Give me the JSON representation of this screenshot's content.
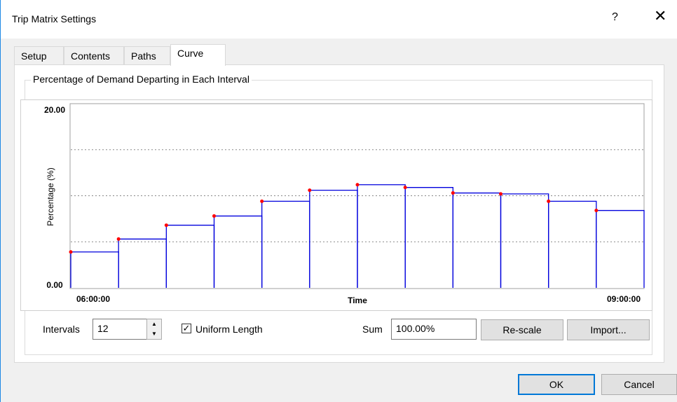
{
  "window": {
    "title": "Trip Matrix Settings",
    "help_glyph": "?",
    "close_glyph": "✕"
  },
  "tabs": [
    {
      "label": "Setup",
      "active": false
    },
    {
      "label": "Contents",
      "active": false
    },
    {
      "label": "Paths",
      "active": false
    },
    {
      "label": "Curve",
      "active": true
    }
  ],
  "group": {
    "label": "Percentage of Demand Departing in Each Interval"
  },
  "chart_data": {
    "type": "step",
    "ylabel": "Percentage (%)",
    "xlabel": "Time",
    "ymin_label": "0.00",
    "ymax_label": "20.00",
    "x_start_label": "06:00:00",
    "x_end_label": "09:00:00",
    "ylim": [
      0,
      20
    ],
    "gridlines": [
      5,
      10,
      15
    ],
    "grid": true,
    "intervals": 12,
    "values": [
      3.9,
      5.3,
      6.8,
      7.8,
      9.4,
      10.6,
      11.2,
      10.9,
      10.3,
      10.2,
      9.4,
      8.4
    ],
    "colors": {
      "line": "#0000dd",
      "point": "#ff0000",
      "grid": "#888888"
    }
  },
  "controls": {
    "intervals_label": "Intervals",
    "intervals_value": "12",
    "uniform_label": "Uniform Length",
    "uniform_checked": true,
    "check_glyph": "✓",
    "spin_up_glyph": "▲",
    "spin_down_glyph": "▼",
    "sum_label": "Sum",
    "sum_value": "100.00%",
    "rescale_label": "Re-scale",
    "import_label": "Import..."
  },
  "footer": {
    "ok_label": "OK",
    "cancel_label": "Cancel"
  }
}
